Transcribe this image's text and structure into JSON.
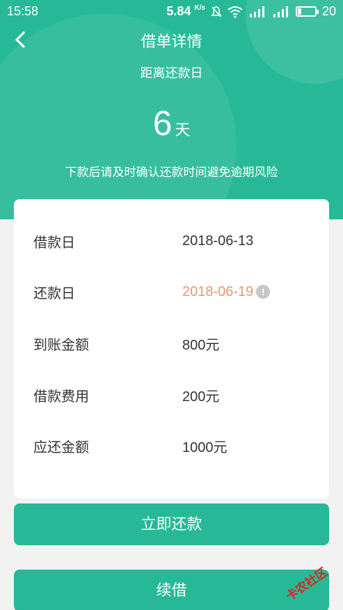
{
  "status_bar": {
    "time": "15:58",
    "speed": "5.84",
    "speed_unit": "K/s",
    "battery": "20"
  },
  "header": {
    "title": "借单详情",
    "subtitle": "距离还款日",
    "days_number": "6",
    "days_unit": "天",
    "notice": "下款后请及时确认还款时间避免逾期风险"
  },
  "details": {
    "rows": [
      {
        "label": "借款日",
        "value": "2018-06-13"
      },
      {
        "label": "还款日",
        "value": "2018-06-19"
      },
      {
        "label": "到账金额",
        "value": "800元"
      },
      {
        "label": "借款费用",
        "value": "200元"
      },
      {
        "label": "应还金额",
        "value": "1000元"
      }
    ],
    "info_icon": "!"
  },
  "actions": {
    "repay_label": "立即还款",
    "renew_label": "续借"
  },
  "watermark": {
    "text": "卡农社区"
  },
  "colors": {
    "primary": "#27b997",
    "due_date": "#e7996a",
    "watermark": "#d9271e"
  },
  "icons": {
    "back": "chevron-left-icon",
    "info": "info-icon",
    "wifi": "wifi-icon",
    "signal": "signal-icon",
    "battery": "battery-icon",
    "mute": "mute-icon"
  }
}
